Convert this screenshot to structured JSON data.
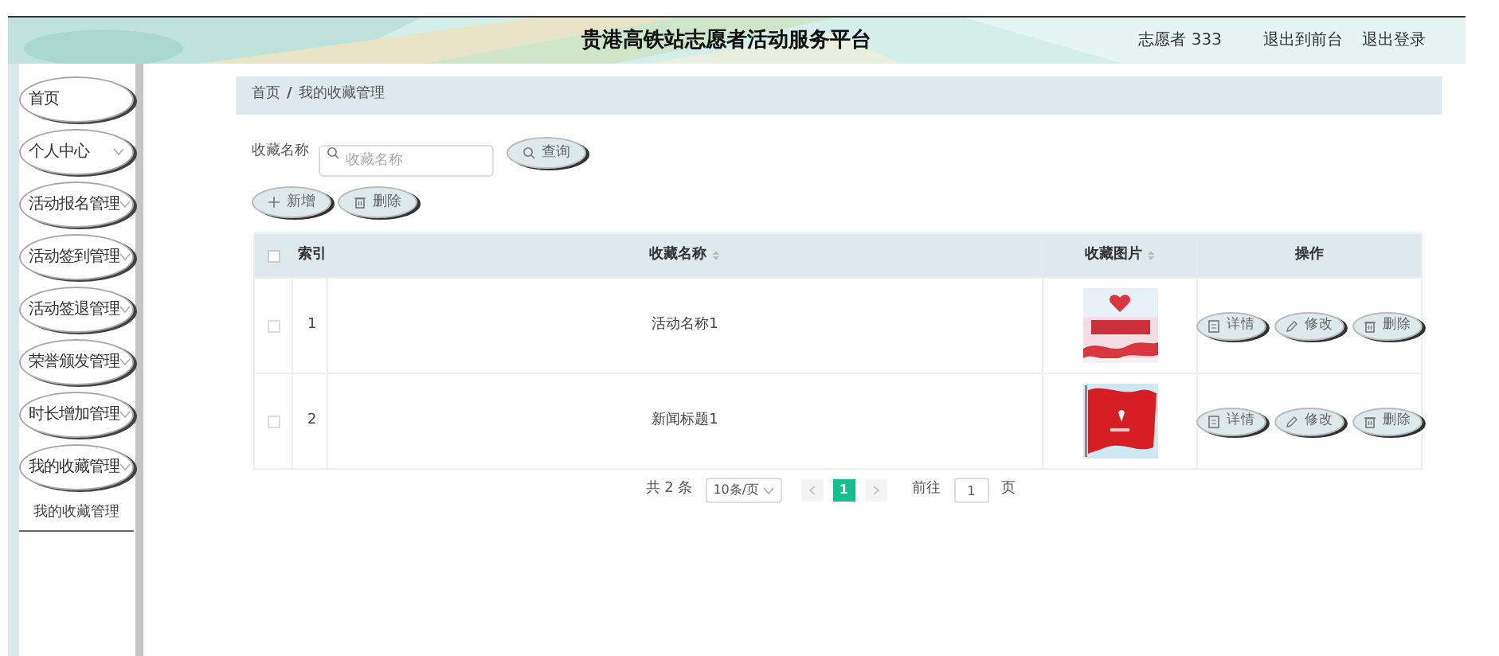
{
  "header": {
    "title": "贵港高铁站志愿者活动服务平台",
    "user_label": "志愿者 333",
    "links": [
      "退出到前台",
      "退出登录"
    ]
  },
  "sidebar": {
    "items": [
      {
        "label": "首页",
        "kind": "link"
      },
      {
        "label": "个人中心",
        "kind": "menu"
      },
      {
        "label": "活动报名管理",
        "kind": "menu"
      },
      {
        "label": "活动签到管理",
        "kind": "menu"
      },
      {
        "label": "活动签退管理",
        "kind": "menu"
      },
      {
        "label": "荣誉颁发管理",
        "kind": "menu"
      },
      {
        "label": "时长增加管理",
        "kind": "menu"
      },
      {
        "label": "我的收藏管理",
        "kind": "menu",
        "children": [
          {
            "label": "我的收藏管理"
          }
        ]
      }
    ]
  },
  "breadcrumb": {
    "items": [
      "首页",
      "我的收藏管理"
    ],
    "separator": "/"
  },
  "search": {
    "label": "收藏名称",
    "placeholder": "收藏名称",
    "button": "查询"
  },
  "actions": [
    {
      "label": "新增",
      "kind": "add"
    },
    {
      "label": "删除",
      "kind": "delete"
    }
  ],
  "table": {
    "header_checked": false,
    "columns": [
      {
        "label": "索引",
        "sortable": false
      },
      {
        "label": "收藏名称",
        "sortable": true
      },
      {
        "label": "收藏图片",
        "sortable": true
      },
      {
        "label": "操作",
        "sortable": false
      }
    ],
    "rows": [
      {
        "checked": false,
        "index": "1",
        "name": "活动名称1",
        "image": {
          "kind": "picture"
        },
        "actions": [
          {
            "label": "详情",
            "kind": "detail"
          },
          {
            "label": "修改",
            "kind": "edit"
          },
          {
            "label": "删除",
            "kind": "delete"
          }
        ]
      },
      {
        "checked": false,
        "index": "2",
        "name": "新闻标题1",
        "image": {
          "kind": "picture"
        },
        "actions": [
          {
            "label": "详情",
            "kind": "detail"
          },
          {
            "label": "修改",
            "kind": "edit"
          },
          {
            "label": "删除",
            "kind": "delete"
          }
        ]
      }
    ]
  },
  "pagination": {
    "total": "共 2 条",
    "page_size": "10条/页",
    "pages": [
      {
        "label": "1",
        "selected": true
      }
    ],
    "goto_label": "前往",
    "goto_value": "1",
    "page_unit": "页"
  }
}
